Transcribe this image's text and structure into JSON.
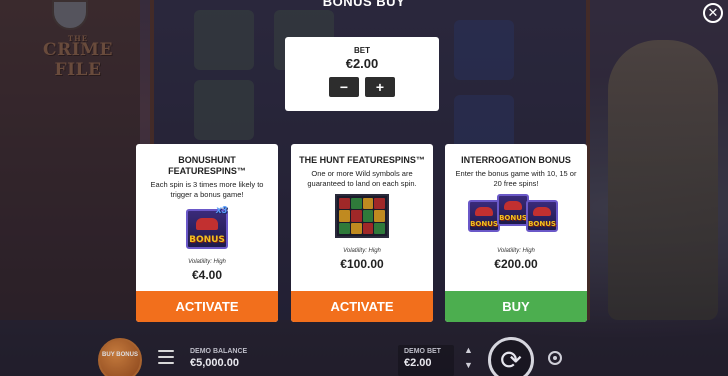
{
  "game": {
    "logo_small": "THE",
    "logo_main": "CRIME FILE"
  },
  "header": {
    "title": "BONUS BUY",
    "close_glyph": "✕"
  },
  "bet": {
    "label": "BET",
    "value": "€2.00",
    "decrease": "−",
    "increase": "+"
  },
  "cards": [
    {
      "title": "BONUSHUNT FEATURESPINS™",
      "description": "Each spin is 3 times more likely to trigger a bonus game!",
      "art_word": "BONUS",
      "art_multiplier": "x3",
      "volatility": "Volatility: High",
      "price": "€4.00",
      "button": "ACTIVATE",
      "button_color": "#f26f1c"
    },
    {
      "title": "THE HUNT FEATURESPINS™",
      "description": "One or more Wild symbols are guaranteed to land on each spin.",
      "volatility": "Volatility: High",
      "price": "€100.00",
      "button": "ACTIVATE",
      "button_color": "#f26f1c"
    },
    {
      "title": "INTERROGATION BONUS",
      "description": "Enter the bonus game with 10, 15 or 20 free spins!",
      "art_word": "BONUS",
      "volatility": "Volatility: High",
      "price": "€200.00",
      "button": "BUY",
      "button_color": "#4cae4f"
    }
  ],
  "bottom_bar": {
    "buy_bonus_label": "BUY BONUS",
    "balance_label": "DEMO BALANCE",
    "balance_value": "€5,000.00",
    "bet_label": "DEMO BET",
    "bet_value": "€2.00"
  },
  "icons": {
    "close": "close-icon",
    "minus": "minus-icon",
    "plus": "plus-icon",
    "menu": "menu-icon",
    "spin": "spin-icon",
    "autoplay": "autoplay-icon",
    "bet_up": "chevron-up-icon",
    "bet_down": "chevron-down-icon"
  }
}
